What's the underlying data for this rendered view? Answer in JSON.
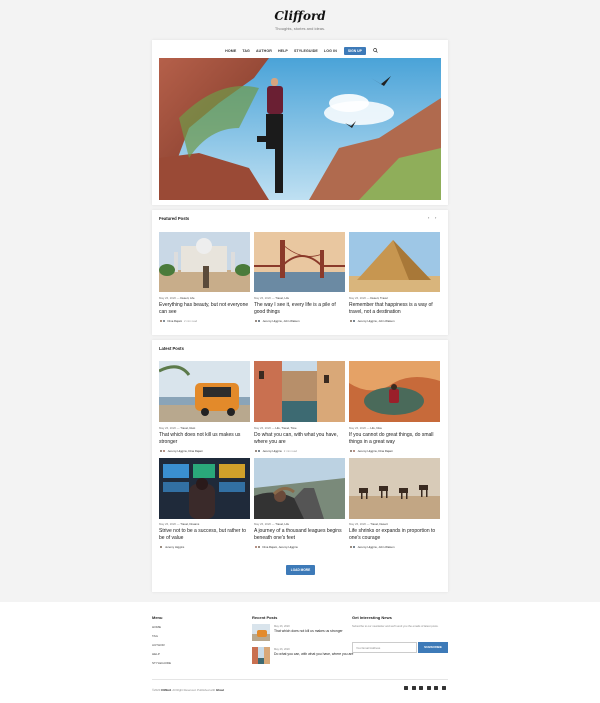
{
  "header": {
    "logo": "Clifford",
    "tagline": "Thoughts, stories and ideas."
  },
  "nav": {
    "items": [
      "HOME",
      "TAG",
      "AUTHOR",
      "HELP",
      "STYLEGUIDE",
      "LOG IN"
    ],
    "signup_label": "SIGN UP",
    "search_icon": "search-icon"
  },
  "featured": {
    "title": "Featured Posts",
    "prev_icon": "‹",
    "next_icon": "›",
    "posts": [
      {
        "date": "May 26, 2020",
        "category": "Desert, Life",
        "title": "Everything has beauty, but not everyone can see",
        "author": "Dina Rajani",
        "read": "2 min read"
      },
      {
        "date": "May 26, 2020",
        "category": "Travel, Life",
        "title": "The way I see it, every life is a pile of good things",
        "author": "Jeremy Higgins, John Watson",
        "read": ""
      },
      {
        "date": "May 26, 2020",
        "category": "Desert, Travel",
        "title": "Remember that happiness is a way of travel, not a destination",
        "author": "Jeremy Higgins, John Watson",
        "read": ""
      }
    ]
  },
  "latest": {
    "title": "Latest Posts",
    "posts": [
      {
        "date": "May 26, 2020",
        "category": "Travel, Rest",
        "title": "That which does not kill us makes us stronger",
        "author": "Jeremy Higgins, Dina Rajani",
        "read": ""
      },
      {
        "date": "May 26, 2020",
        "category": "Life, Travel, Time",
        "title": "Do what you can, with what you have, where you are",
        "author": "Jeremy Higgins",
        "read": "2 min read"
      },
      {
        "date": "May 26, 2020",
        "category": "Life, Nice",
        "title": "If you cannot do great things, do small things in a great way",
        "author": "Jeremy Higgins, Dina Rajani",
        "read": ""
      },
      {
        "date": "May 26, 2020",
        "category": "Travel, Dreams",
        "title": "Strive not to be a success, but rather to be of value",
        "author": "Jeremy Higgins",
        "read": ""
      },
      {
        "date": "May 26, 2020",
        "category": "Travel, Life",
        "title": "A journey of a thousand leagues begins beneath one's feet",
        "author": "Dina Rajani, Jeremy Higgins",
        "read": ""
      },
      {
        "date": "May 26, 2020",
        "category": "Travel, Desert",
        "title": "Life shrinks or expands in proportion to one's courage",
        "author": "Jeremy Higgins, John Watson",
        "read": ""
      }
    ],
    "load_more": "LOAD MORE"
  },
  "footer": {
    "menu_title": "Menu",
    "menu_items": [
      "HOME",
      "TAG",
      "AUTHOR",
      "HELP",
      "STYLEGUIDE"
    ],
    "recent_title": "Recent Posts",
    "recent": [
      {
        "date": "May 26, 2020",
        "title": "That which does not kill us makes us stronger"
      },
      {
        "date": "May 26, 2020",
        "title": "Do what you can, with what you have, where you are"
      }
    ],
    "news_title": "Get Interesting News",
    "news_text": "Subscribe to our newsletter and we'll send you the emails of latest posts.",
    "email_placeholder": "Your Email Address",
    "subscribe_label": "SUBSCRIBE",
    "copyright_prefix": "©2020",
    "copyright_brand": "Clifford",
    "copyright_suffix": ". All Right Reserved. Published with",
    "copyright_ghost": "Ghost",
    "socials": [
      "twitter-icon",
      "facebook-icon",
      "instagram-icon",
      "pinterest-icon",
      "github-icon",
      "youtube-icon"
    ]
  },
  "colors": {
    "accent": "#3d7ab8",
    "background": "#f3f3f3"
  }
}
